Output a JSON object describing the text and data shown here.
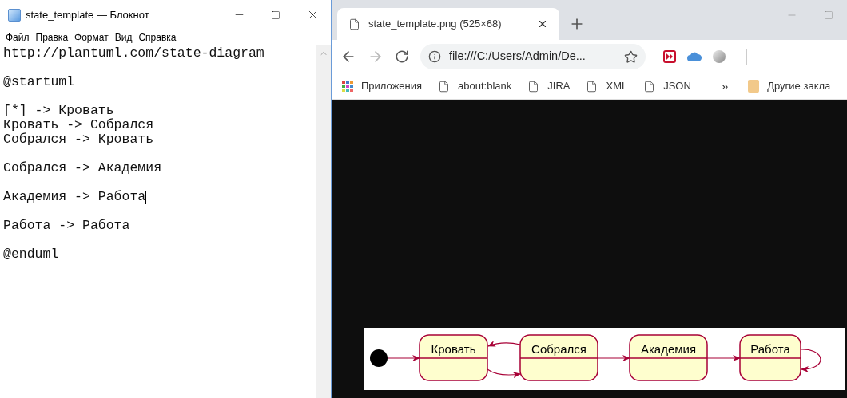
{
  "notepad": {
    "title": "state_template — Блокнот",
    "menu": [
      "Файл",
      "Правка",
      "Формат",
      "Вид",
      "Справка"
    ],
    "paragraphs": [
      [
        {
          "text": "http://plantuml.com/state-diagram",
          "cursor": false
        }
      ],
      [
        {
          "text": "@startuml",
          "cursor": false
        }
      ],
      [
        {
          "text": "[*] -> Кровать",
          "cursor": false
        },
        {
          "text": "Кровать -> Собрался",
          "cursor": false
        },
        {
          "text": "Собрался -> Кровать",
          "cursor": false
        }
      ],
      [
        {
          "text": "Собрался -> Академия",
          "cursor": false
        }
      ],
      [
        {
          "text": "Академия -> Работа",
          "cursor": true
        }
      ],
      [
        {
          "text": "Работа -> Работа",
          "cursor": false
        }
      ],
      [
        {
          "text": "@enduml",
          "cursor": false
        }
      ]
    ]
  },
  "browser": {
    "tabs": [
      {
        "title": "state_template.png (525×68)",
        "selected": true
      }
    ],
    "forward": {
      "disabled": true
    },
    "address": "file:///C:/Users/Admin/De...",
    "bookmarks": [
      {
        "label": "Приложения",
        "kind": "apps"
      },
      {
        "label": "about:blank",
        "kind": "page"
      },
      {
        "label": "JIRA",
        "kind": "page"
      },
      {
        "label": "XML",
        "kind": "page"
      },
      {
        "label": "JSON",
        "kind": "page"
      }
    ],
    "overflow": "»",
    "other_bookmarks": "Другие закла",
    "diagram": {
      "states": [
        "Кровать",
        "Собрался",
        "Академия",
        "Работа"
      ]
    }
  }
}
